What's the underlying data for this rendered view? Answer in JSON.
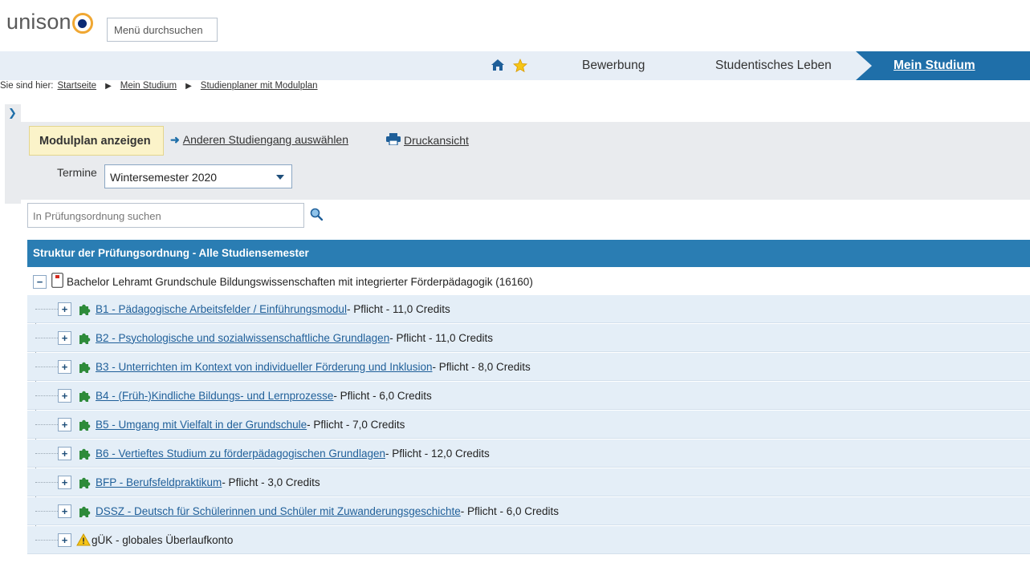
{
  "header": {
    "logo_text": "unison",
    "menu_search_placeholder": "Menü durchsuchen"
  },
  "nav": {
    "items": [
      {
        "label": "Bewerbung"
      },
      {
        "label": "Studentisches Leben"
      },
      {
        "label": "Mein Studium",
        "active": true
      }
    ],
    "icons": [
      "home-icon",
      "star-icon"
    ],
    "active_color": "#1f6fa9"
  },
  "breadcrumb": {
    "prefix": "Sie sind hier:",
    "items": [
      "Startseite",
      "Mein Studium",
      "Studienplaner mit Modulplan"
    ]
  },
  "toolbar": {
    "show_button": "Modulplan anzeigen",
    "other_program_link": "Anderen Studiengang auswählen",
    "print_link": "Druckansicht",
    "termine_label": "Termine",
    "termine_value": "Wintersemester 2020"
  },
  "search": {
    "placeholder": "In Prüfungsordnung suchen"
  },
  "tree": {
    "header": "Struktur der Prüfungsordnung - Alle Studiensemester",
    "root_label": "Bachelor Lehramt Grundschule Bildungswissenschaften mit integrierter Förderpädagogik (16160)",
    "modules": [
      {
        "link": "B1 - Pädagogische Arbeitsfelder / Einführungsmodul",
        "detail": " - Pflicht - 11,0 Credits",
        "icon": "puzzle-icon"
      },
      {
        "link": "B2 - Psychologische und sozialwissenschaftliche Grundlagen",
        "detail": " - Pflicht - 11,0 Credits",
        "icon": "puzzle-icon"
      },
      {
        "link": "B3 - Unterrichten im Kontext von individueller Förderung und Inklusion",
        "detail": " - Pflicht - 8,0 Credits",
        "icon": "puzzle-icon"
      },
      {
        "link": "B4 - (Früh-)Kindliche Bildungs- und Lernprozesse",
        "detail": " - Pflicht - 6,0 Credits",
        "icon": "puzzle-icon"
      },
      {
        "link": "B5 - Umgang mit Vielfalt in der Grundschule",
        "detail": " - Pflicht - 7,0 Credits",
        "icon": "puzzle-icon"
      },
      {
        "link": "B6 - Vertieftes Studium zu förderpädagogischen Grundlagen",
        "detail": " - Pflicht - 12,0 Credits",
        "icon": "puzzle-icon"
      },
      {
        "link": "BFP - Berufsfeldpraktikum",
        "detail": " - Pflicht - 3,0 Credits",
        "icon": "puzzle-icon"
      },
      {
        "link": "DSSZ - Deutsch für Schülerinnen und Schüler mit Zuwanderungsgeschichte",
        "detail": " - Pflicht - 6,0 Credits",
        "icon": "puzzle-icon"
      },
      {
        "plain": "gÜK - globales Überlaufkonto",
        "icon": "warning-icon"
      }
    ]
  }
}
